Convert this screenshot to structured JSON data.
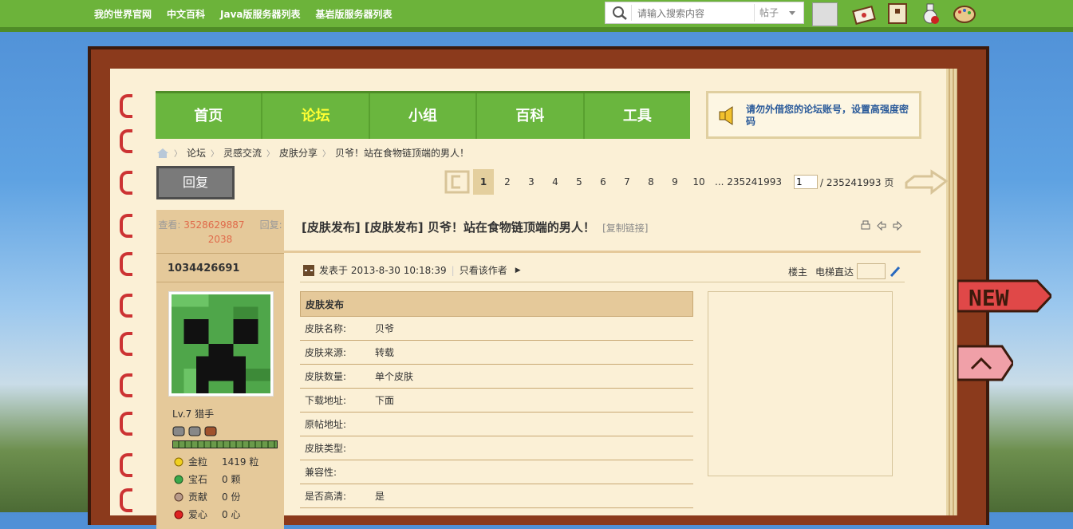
{
  "topnav": [
    "我的世界官网",
    "中文百科",
    "Java版服务器列表",
    "基岩版服务器列表"
  ],
  "search": {
    "placeholder": "请输入搜索内容",
    "type": "帖子"
  },
  "mainnav": [
    {
      "label": "首页",
      "active": false
    },
    {
      "label": "论坛",
      "active": true
    },
    {
      "label": "小组",
      "active": false
    },
    {
      "label": "百科",
      "active": false
    },
    {
      "label": "工具",
      "active": false
    }
  ],
  "notice": "请勿外借您的论坛账号，设置高强度密码",
  "breadcrumb": [
    "论坛",
    "灵感交流",
    "皮肤分享",
    "贝爷！站在食物链顶端的男人！"
  ],
  "reply_label": "回复",
  "pager": {
    "pages": [
      "1",
      "2",
      "3",
      "4",
      "5",
      "6",
      "7",
      "8",
      "9",
      "10",
      "... 235241993"
    ],
    "current": "1",
    "input": "1",
    "total": "/ 235241993 页"
  },
  "stats": {
    "views_label": "查看:",
    "views": "3528629887",
    "replies_label": "回复:",
    "replies": "2038"
  },
  "user": {
    "name": "1034426691",
    "level": "Lv.7 猎手",
    "credits": [
      {
        "icon": "gold-icon",
        "label": "金粒",
        "value": "1419 粒"
      },
      {
        "icon": "gem-icon",
        "label": "宝石",
        "value": "0 颗"
      },
      {
        "icon": "contribution-icon",
        "label": "贡献",
        "value": "0 份"
      },
      {
        "icon": "heart-icon",
        "label": "爱心",
        "value": "0 心"
      }
    ]
  },
  "post": {
    "title": "[皮肤发布] [皮肤发布] 贝爷！站在食物链顶端的男人！",
    "copy_link": "[复制链接]",
    "posted": "发表于 2013-8-30 10:18:39",
    "author_only": "只看该作者",
    "floor": "楼主",
    "jump": "电梯直达"
  },
  "skin_table": {
    "header": "皮肤发布",
    "rows": [
      {
        "k": "皮肤名称:",
        "v": "贝爷"
      },
      {
        "k": "皮肤来源:",
        "v": "转载"
      },
      {
        "k": "皮肤数量:",
        "v": "单个皮肤"
      },
      {
        "k": "下载地址:",
        "v": "下面"
      },
      {
        "k": "原帖地址:",
        "v": ""
      },
      {
        "k": "皮肤类型:",
        "v": ""
      },
      {
        "k": "兼容性:",
        "v": ""
      },
      {
        "k": "是否高清:",
        "v": "是"
      }
    ]
  },
  "colors": {
    "topbar": "#6cb33a",
    "nav": "#6ab63e",
    "active_nav": "#ffff33",
    "page": "#fbf0d6"
  }
}
